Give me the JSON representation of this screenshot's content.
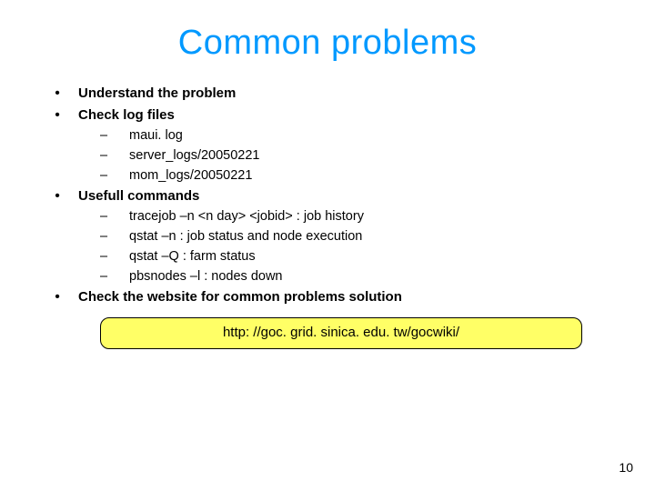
{
  "title": "Common problems",
  "items": {
    "understand": "Understand the problem",
    "checklog": "Check log files",
    "usefull": "Usefull commands",
    "checkweb": "Check the website for common problems solution"
  },
  "logs": {
    "a": "maui. log",
    "b": "server_logs/20050221",
    "c": "mom_logs/20050221"
  },
  "cmds": {
    "a": "tracejob –n <n day> <jobid> : job history",
    "b": "qstat –n : job status and node execution",
    "c": "qstat –Q : farm status",
    "d": "pbsnodes –l : nodes down"
  },
  "url": "http: //goc. grid. sinica. edu. tw/gocwiki/",
  "pagenum": "10"
}
